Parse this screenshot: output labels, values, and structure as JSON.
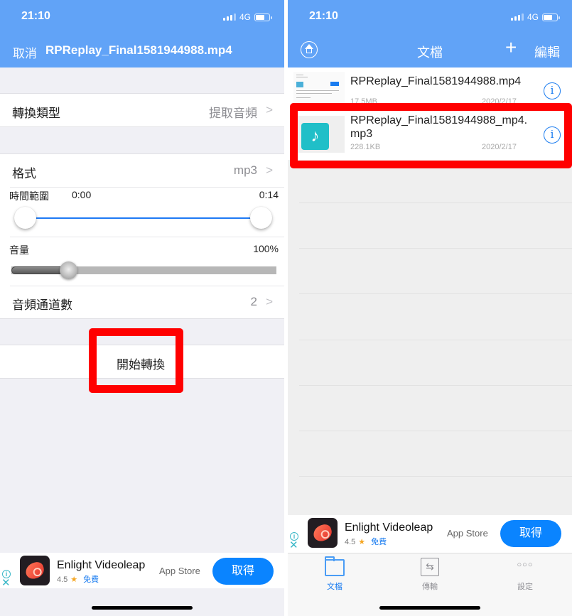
{
  "status_bar": {
    "time": "21:10",
    "network": "4G"
  },
  "left_screen": {
    "nav": {
      "cancel_label": "取消",
      "title": "RPReplay_Final1581944988.mp4"
    },
    "convert_type": {
      "label": "轉換類型",
      "value": "提取音頻"
    },
    "format": {
      "label": "格式",
      "value": "mp3"
    },
    "time_range": {
      "label": "時間範圍",
      "start": "0:00",
      "end": "0:14"
    },
    "volume": {
      "label": "音量",
      "value": "100%"
    },
    "channels": {
      "label": "音頻通道數",
      "value": "2"
    },
    "start_button_label": "開始轉換"
  },
  "right_screen": {
    "nav": {
      "title": "文檔",
      "add_label": "+",
      "edit_label": "編輯"
    },
    "files": [
      {
        "name": "RPReplay_Final1581944988.mp4",
        "size": "17.5MB",
        "date": "2020/2/17",
        "type": "video"
      },
      {
        "name": "RPReplay_Final1581944988_mp4.mp3",
        "name_line1": "RPReplay_Final1581944988_mp4.",
        "name_line2": "mp3",
        "size": "228.1KB",
        "date": "2020/2/17",
        "type": "audio"
      }
    ],
    "tabs": [
      {
        "label": "文檔",
        "icon": "folder-icon",
        "active": true
      },
      {
        "label": "傳輸",
        "icon": "transfer-icon",
        "active": false
      },
      {
        "label": "設定",
        "icon": "more-icon",
        "active": false
      }
    ]
  },
  "ad": {
    "app_name": "Enlight Videoleap",
    "rating": "4.5",
    "price": "免費",
    "store": "App Store",
    "get_label": "取得",
    "info_glyph": "i",
    "close_glyph": "✕"
  },
  "colors": {
    "header_blue": "#61a3f7",
    "accent_blue": "#1a7cf0",
    "highlight_red": "#ff0000",
    "audio_teal": "#20bfc8"
  }
}
